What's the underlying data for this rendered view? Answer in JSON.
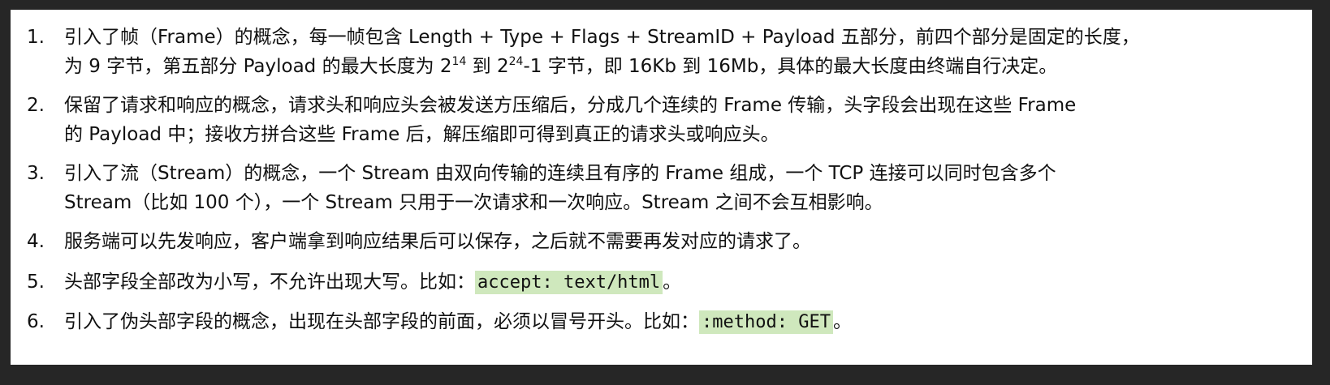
{
  "items": [
    {
      "num": "1.",
      "line1": "引入了帧（Frame）的概念，每一帧包含 Length + Type + Flags + StreamID + Payload 五部分，前四个部分是固定的长度，",
      "line2_a": "为 9 字节，第五部分 Payload 的最大长度为 2",
      "line2_sup1": "14",
      "line2_b": " 到 2",
      "line2_sup2": "24",
      "line2_c": "-1 字节，即 16Kb 到 16Mb，具体的最大长度由终端自行决定。"
    },
    {
      "num": "2.",
      "line1": "保留了请求和响应的概念，请求头和响应头会被发送方压缩后，分成几个连续的 Frame 传输，头字段会出现在这些 Frame",
      "line2": "的 Payload 中；接收方拼合这些 Frame 后，解压缩即可得到真正的请求头或响应头。"
    },
    {
      "num": "3.",
      "line1": "引入了流（Stream）的概念，一个 Stream 由双向传输的连续且有序的 Frame 组成，一个 TCP 连接可以同时包含多个",
      "line2": "Stream（比如 100 个），一个 Stream 只用于一次请求和一次响应。Stream 之间不会互相影响。"
    },
    {
      "num": "4.",
      "line1": "服务端可以先发响应，客户端拿到响应结果后可以保存，之后就不需要再发对应的请求了。"
    },
    {
      "num": "5.",
      "line1": "头部字段全部改为小写，不允许出现大写。比如：",
      "code": "accept: text/html",
      "tail": "。"
    },
    {
      "num": "6.",
      "line1": "引入了伪头部字段的概念，出现在头部字段的前面，必须以冒号开头。比如：",
      "code": ":method: GET",
      "tail": "。"
    }
  ]
}
